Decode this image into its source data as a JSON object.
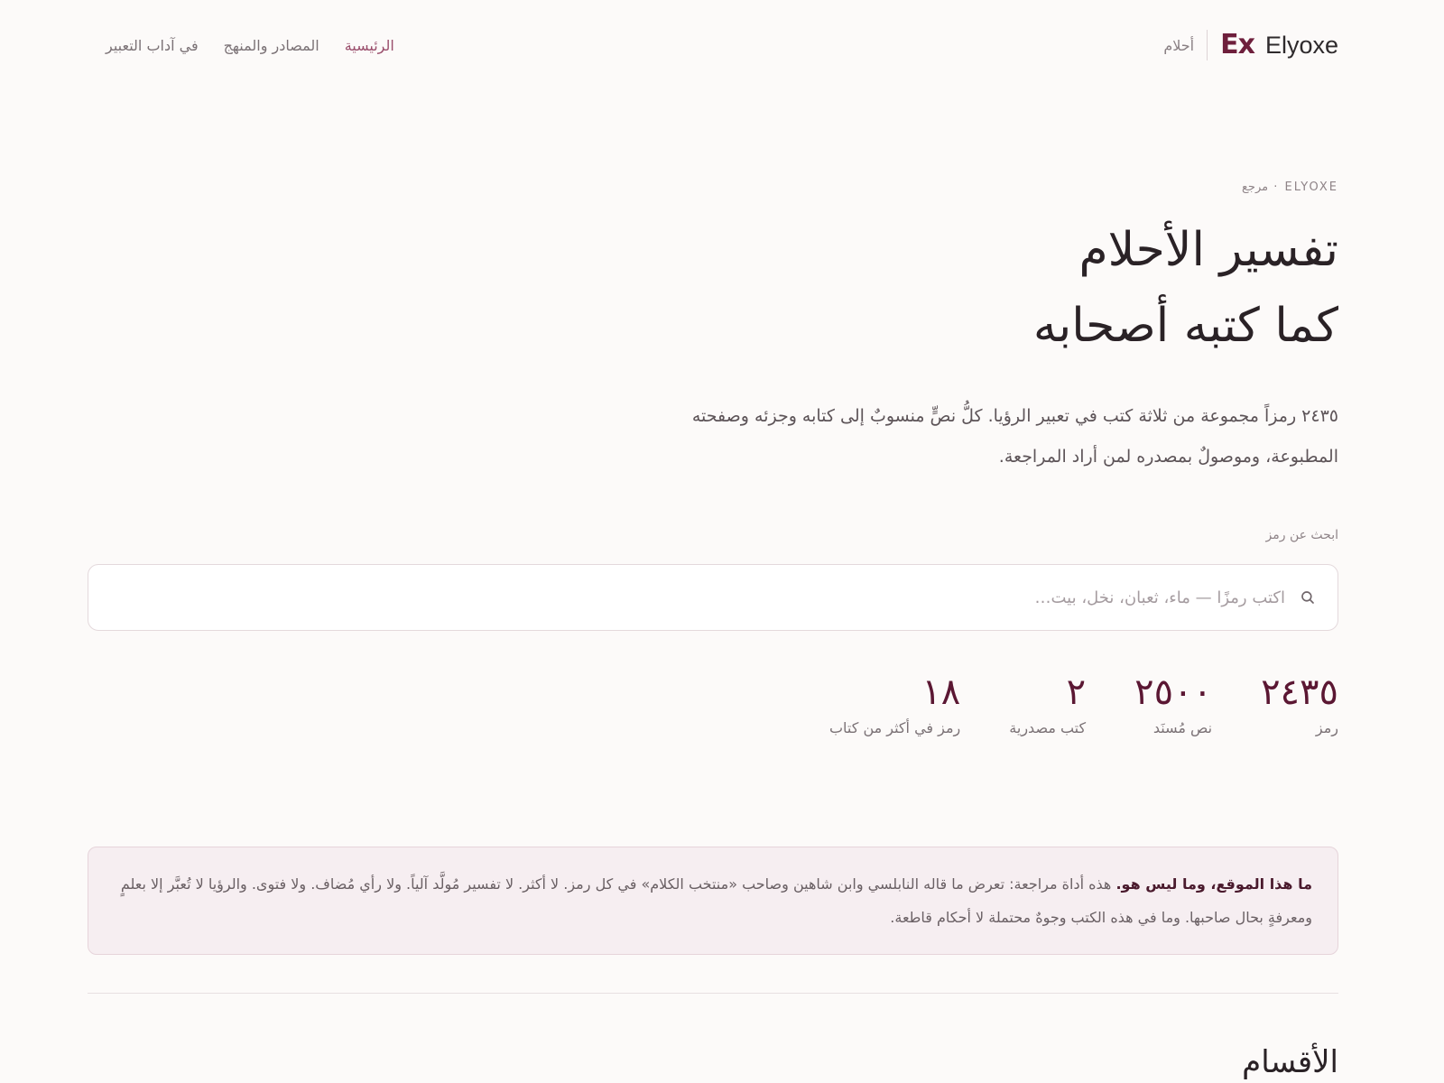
{
  "header": {
    "brand_logo": "Ex",
    "brand_name": "Elyoxe",
    "section": "أحلام",
    "nav": [
      {
        "label": "الرئيسية",
        "active": true
      },
      {
        "label": "المصادر والمنهج",
        "active": false
      },
      {
        "label": "في آداب التعبير",
        "active": false
      }
    ]
  },
  "hero": {
    "eyebrow": "ELYOXE · مرجع",
    "title_line1": "تفسير الأحلام",
    "title_line2": "كما كتبه أصحابه",
    "description": "٢٤٣٥ رمزاً مجموعة من ثلاثة كتب في تعبير الرؤيا. كلُّ نصٍّ منسوبٌ إلى كتابه وجزئه وصفحته المطبوعة، وموصولٌ بمصدره لمن أراد المراجعة."
  },
  "search": {
    "label": "ابحث عن رمز",
    "placeholder": "اكتب رمزًا — ماء، ثعبان، نخل، بيت…",
    "icon": "search-icon"
  },
  "stats": [
    {
      "value": "٢٤٣٥",
      "label": "رمز"
    },
    {
      "value": "٢٥٠٠",
      "label": "نص مُسنَد"
    },
    {
      "value": "٢",
      "label": "كتب مصدرية"
    },
    {
      "value": "١٨",
      "label": "رمز في أكثر من كتاب"
    }
  ],
  "note": {
    "lead": "ما هذا الموقع، وما ليس هو.",
    "body": " هذه أداة مراجعة: تعرض ما قاله النابلسي وابن شاهين وصاحب «منتخب الكلام» في كل رمز. لا أكثر. لا تفسير مُولَّد آلياً. ولا رأي مُضاف. ولا فتوى. والرؤيا لا تُعبَّر إلا بعلمٍ ومعرفةٍ بحال صاحبها. وما في هذه الكتب وجوهٌ محتملة لا أحكام قاطعة."
  },
  "sections": {
    "title": "الأقسام"
  },
  "colors": {
    "accent": "#5b1733",
    "nav_active": "#9a4e6c",
    "background": "#fcfaf9",
    "note_background": "#f6eef1"
  }
}
